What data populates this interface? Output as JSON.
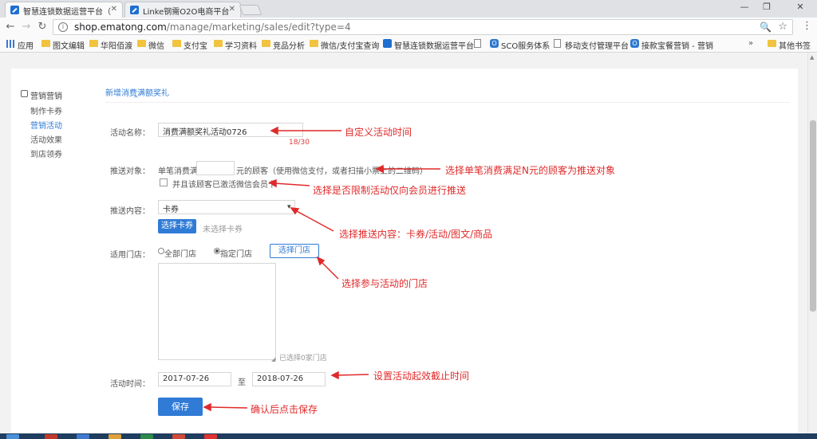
{
  "browser": {
    "tabs": [
      {
        "title": "智慧连锁数据运营平台（",
        "active": true
      },
      {
        "title": "Linke钢需O2O电商平台",
        "active": false
      }
    ],
    "url_host": "shop.ematong.com",
    "url_path": "/manage/marketing/sales/edit?type=4",
    "bookmarks": [
      "应用",
      "图文编辑",
      "华阳佰渡",
      "微信",
      "支付宝",
      "学习资料",
      "竞品分析",
      "微信/支付宝查询",
      "智慧连锁数据运营平台",
      "",
      "SCO服务体系",
      "移动支付管理平台",
      "接款宝餐营销 - 营销"
    ],
    "bookmarks_more": "其他书签"
  },
  "sidebar": {
    "title": "营销营销",
    "items": [
      {
        "label": "制作卡券",
        "active": false
      },
      {
        "label": "营销活动",
        "active": true
      },
      {
        "label": "活动效果",
        "active": false
      },
      {
        "label": "到店领券",
        "active": false
      }
    ]
  },
  "page": {
    "tab_label": "新增消费满额奖礼",
    "form": {
      "name_label": "活动名称：",
      "name_value": "消费满额奖礼活动0726",
      "name_counter": "18/30",
      "target_label": "推送对象：",
      "target_prefix": "单笔消费满",
      "target_suffix": "元的顾客（使用微信支付，或者扫描小票上的二维码）",
      "target_checkbox_label": "并且该顾客已激活微信会员卡",
      "content_label": "推送内容：",
      "content_value": "卡券",
      "choose_coupon_btn": "选择卡券",
      "no_coupon_text": "未选择卡券",
      "store_label": "适用门店：",
      "store_all": "全部门店",
      "store_specific": "指定门店",
      "choose_store_btn": "选择门店",
      "selected_count": "已选择0家门店",
      "time_label": "活动时间：",
      "start_date": "2017-07-26",
      "to_text": "至",
      "end_date": "2018-07-26",
      "save_btn": "保存"
    }
  },
  "annotations": [
    "自定义活动时间",
    "选择单笔消费满足N元的顾客为推送对象",
    "选择是否限制活动仅向会员进行推送",
    "选择推送内容：卡券/活动/图文/商品",
    "选择参与活动的门店",
    "设置活动起效截止时间",
    "确认后点击保存"
  ],
  "colors": {
    "accent": "#2f7bd6",
    "annotation": "#e02a2a"
  }
}
